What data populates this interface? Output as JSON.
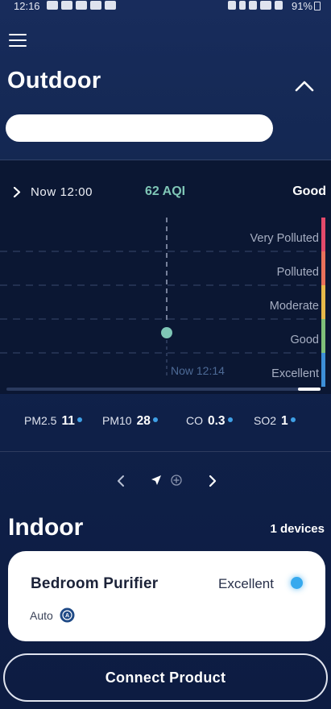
{
  "status_bar": {
    "time": "12:16",
    "battery_percent": "91%",
    "left_icons": [
      "youtube-icon",
      "youtube-icon",
      "video-icon",
      "gmail-icon",
      "grid-icon"
    ],
    "right_icons": [
      "alarm-icon",
      "bluetooth-icon",
      "mute-icon",
      "wifi-icon",
      "signal-icon",
      "battery-icon"
    ]
  },
  "header": {
    "menu_icon": "hamburger-menu-icon",
    "title": "Outdoor",
    "collapse_icon": "chevron-up-icon"
  },
  "outdoor": {
    "now_label": "Now 12:00",
    "aqi": "62 AQI",
    "status": "Good",
    "aqi_color": "#7fc6b6",
    "chart_levels": [
      "Very Polluted",
      "Polluted",
      "Moderate",
      "Good",
      "Excellent"
    ],
    "marker_label": "Now 12:14",
    "marker_color": "#7fc6b6",
    "scale_colors": [
      "#e44a6b",
      "#e9715b",
      "#e6b94a",
      "#7fc07a",
      "#3d8fd8"
    ],
    "current_level_index": 3
  },
  "pollutants": [
    {
      "name": "PM2.5",
      "value": "11"
    },
    {
      "name": "PM10",
      "value": "28"
    },
    {
      "name": "CO",
      "value": "0.3"
    },
    {
      "name": "SO2",
      "value": "1"
    }
  ],
  "pager": {
    "prev_icon": "chevron-left-icon",
    "location_icon": "location-arrow-icon",
    "add_icon": "add-location-icon",
    "next_icon": "chevron-right-icon"
  },
  "indoor": {
    "title": "Indoor",
    "device_count": "1 devices",
    "devices": [
      {
        "name": "Bedroom Purifier",
        "status": "Excellent",
        "mode": "Auto",
        "status_color": "#36a9ee"
      }
    ]
  },
  "connect_button": {
    "label": "Connect Product"
  }
}
